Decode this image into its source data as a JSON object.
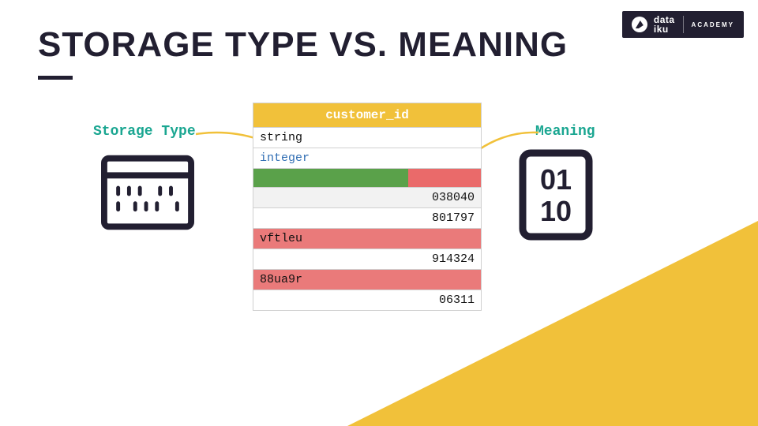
{
  "brand": {
    "name_top": "data",
    "name_bot": "iku",
    "academy": "ACADEMY"
  },
  "title": "STORAGE TYPE VS. MEANING",
  "labels": {
    "storage": "Storage Type",
    "meaning": "Meaning"
  },
  "column": {
    "header": "customer_id",
    "storage_type": "string",
    "meaning": "integer",
    "bar": {
      "ok_pct": 68,
      "bad_pct": 32
    },
    "rows": [
      {
        "value": "038040",
        "invalid": false,
        "selected": true
      },
      {
        "value": "801797",
        "invalid": false,
        "selected": false
      },
      {
        "value": "vftleu",
        "invalid": true,
        "selected": false
      },
      {
        "value": "914324",
        "invalid": false,
        "selected": false
      },
      {
        "value": "88ua9r",
        "invalid": true,
        "selected": false
      },
      {
        "value": "06311",
        "invalid": false,
        "selected": false
      }
    ]
  },
  "binary_glyph": {
    "top": "01",
    "bot": "10"
  },
  "colors": {
    "accent": "#f1c13a",
    "ok": "#5aa14a",
    "bad": "#ea6a6a",
    "teal": "#1aa691",
    "dark": "#221f31"
  }
}
